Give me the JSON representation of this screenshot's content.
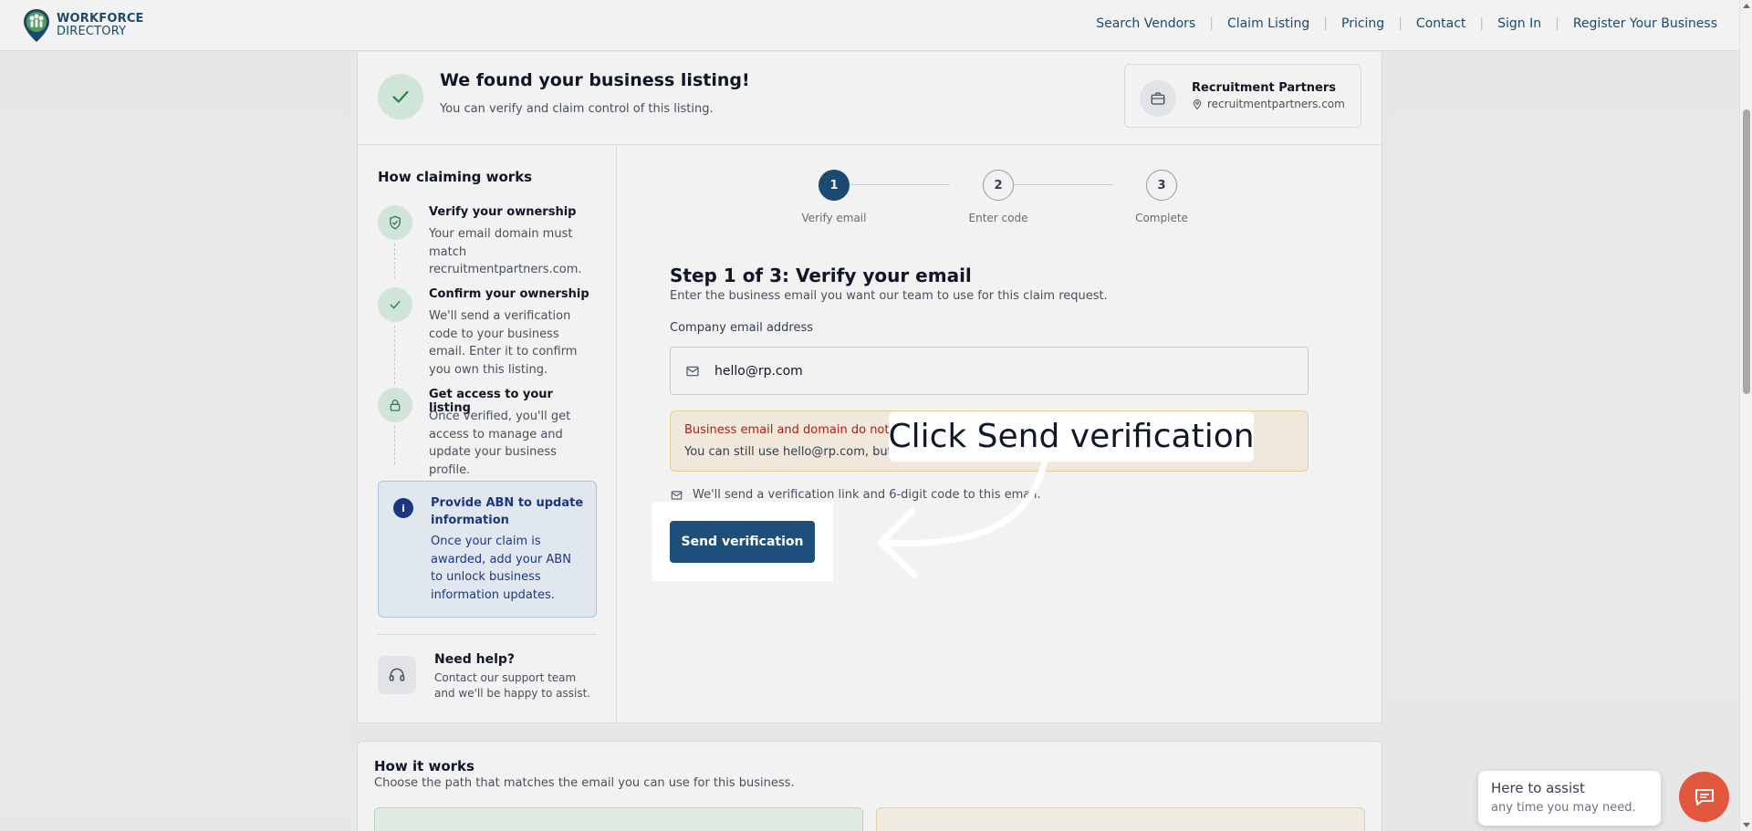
{
  "brand": {
    "line1": "WORKFORCE",
    "line2": "DIRECTORY"
  },
  "nav": [
    "Search Vendors",
    "Claim Listing",
    "Pricing",
    "Contact",
    "Sign In",
    "Register Your Business"
  ],
  "found": {
    "title": "We found your business listing!",
    "subtitle": "You can verify and claim control of this listing."
  },
  "business": {
    "name": "Recruitment Partners",
    "domain": "recruitmentpartners.com"
  },
  "how_claiming": {
    "title": "How claiming works",
    "steps": [
      {
        "name": "Verify your ownership",
        "desc": "Your email domain must match recruitmentpartners.com.",
        "icon": "shield-check-icon"
      },
      {
        "name": "Confirm your ownership",
        "desc": "We'll send a verification code to your business email. Enter it to confirm you own this listing.",
        "icon": "check-icon"
      },
      {
        "name": "Get access to your listing",
        "desc": "Once verified, you'll get access to manage and update your business profile.",
        "icon": "lock-icon"
      }
    ]
  },
  "abn": {
    "title": "Provide ABN to update information",
    "desc": "Once your claim is awarded, add your ABN to unlock business information updates."
  },
  "help": {
    "title": "Need help?",
    "desc": "Contact our support team and we'll be happy to assist."
  },
  "stepper": [
    {
      "number": "1",
      "label": "Verify email"
    },
    {
      "number": "2",
      "label": "Enter code"
    },
    {
      "number": "3",
      "label": "Complete"
    }
  ],
  "form": {
    "heading": "Step 1 of 3: Verify your email",
    "subheading": "Enter the business email you want our team to use for this claim request.",
    "email_label": "Company email address",
    "email_value": "hello@rp.com",
    "warning_title": "Business email and domain do not ma",
    "warning_desc": "You can still use hello@rp.com, but ou",
    "note": "We'll send a verification link and 6-digit code to this email.",
    "button_label": "Send verification"
  },
  "how_it_works": {
    "title": "How it works",
    "subtitle": "Choose the path that matches the email you can use for this business."
  },
  "callout": {
    "text": "Click Send verification"
  },
  "assist": {
    "title": "Here to assist",
    "subtitle": "any time you may need."
  },
  "colors": {
    "primary": "#1e4f7a",
    "success_bg": "#dcf2e3",
    "success": "#2f855a",
    "warning_text": "#b42318",
    "chat": "#e2583e"
  }
}
